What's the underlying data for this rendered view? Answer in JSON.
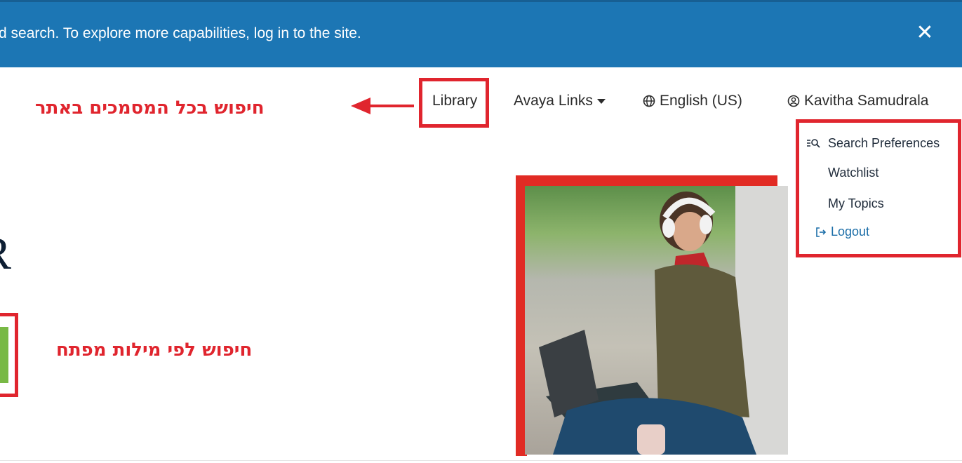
{
  "banner": {
    "text": "d search. To explore more capabilities, log in to the site.",
    "close_label": "✕"
  },
  "nav": {
    "library": "Library",
    "avaya_links": "Avaya Links",
    "language": "English (US)",
    "user": "Kavitha Samudrala"
  },
  "user_menu": {
    "items": [
      {
        "label": "Search Preferences",
        "icon": "search-preferences-icon"
      },
      {
        "label": "Watchlist"
      },
      {
        "label": "My Topics"
      },
      {
        "label": "Logout",
        "icon": "logout-icon"
      }
    ]
  },
  "annotations": {
    "site_search": "חיפוש בכל המסמכים באתר",
    "keyword_search": "חיפוש לפי מילות מפתח"
  },
  "hero": {
    "partial_letter": "R"
  },
  "colors": {
    "banner": "#1c76b4",
    "annotation_red": "#e0252e",
    "search_button_green": "#78b945",
    "logout_blue": "#1c6ea8"
  }
}
